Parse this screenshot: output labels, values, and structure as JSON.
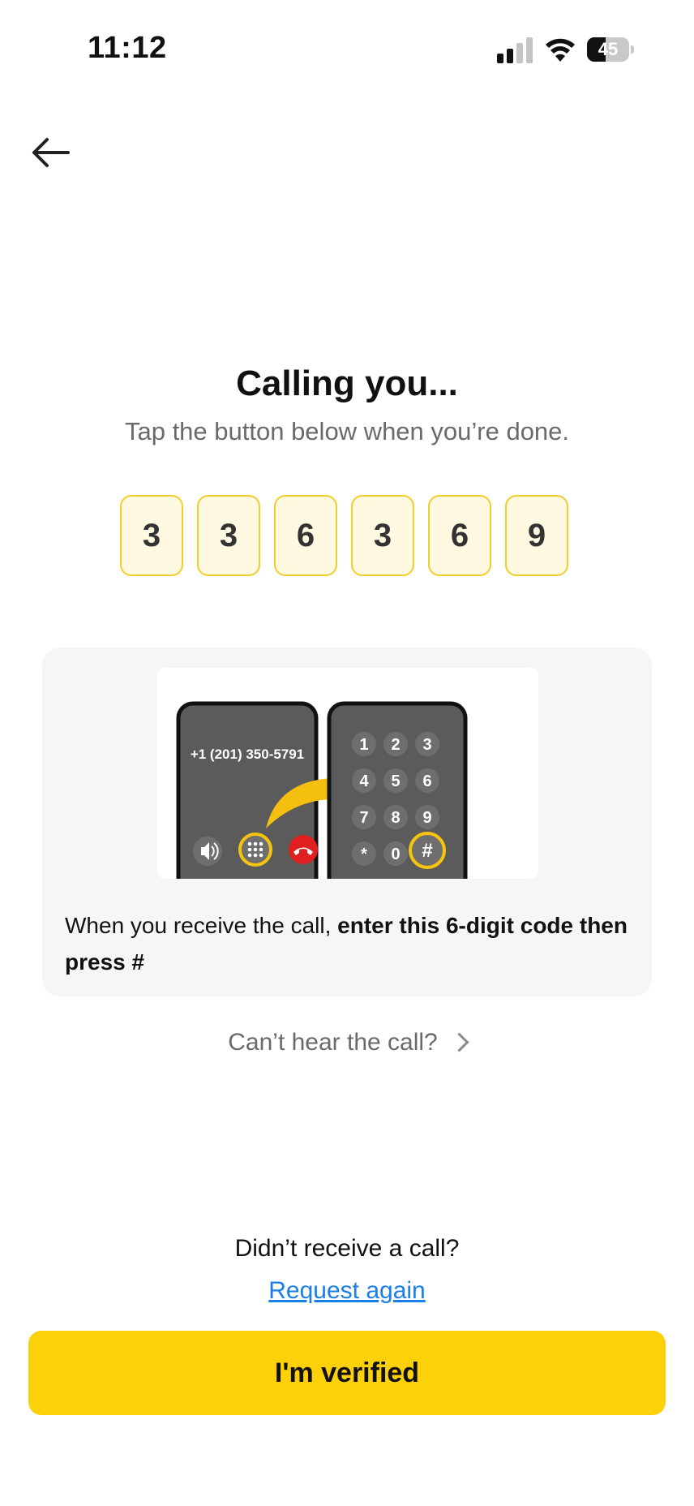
{
  "status_bar": {
    "time": "11:12",
    "battery": "45",
    "battery_level": 0.45
  },
  "page": {
    "title": "Calling you...",
    "subtitle": "Tap the button below when you’re done."
  },
  "code_digits": [
    "3",
    "3",
    "6",
    "3",
    "6",
    "9"
  ],
  "instructions": {
    "phone_number": "+1 (201) 350-5791",
    "keypad_keys": [
      "1",
      "2",
      "3",
      "4",
      "5",
      "6",
      "7",
      "8",
      "9",
      "*",
      "0",
      "#"
    ],
    "text_prefix": "When you receive the call, ",
    "text_bold": "enter this 6-digit code then press #"
  },
  "links": {
    "cant_hear": "Can’t hear the call?",
    "didnt_receive": "Didn’t receive a call?",
    "request_again": "Request again"
  },
  "primary_button": {
    "label": "I'm verified"
  },
  "colors": {
    "accent": "#fdd10a",
    "code_border": "#f4cd2c",
    "code_bg": "#fff9e2",
    "link": "#1a7fe6"
  },
  "icons": [
    "back-arrow-icon",
    "signal-icon",
    "wifi-icon",
    "battery-icon",
    "chevron-right-icon",
    "speaker-icon",
    "keypad-icon",
    "hang-up-icon"
  ]
}
